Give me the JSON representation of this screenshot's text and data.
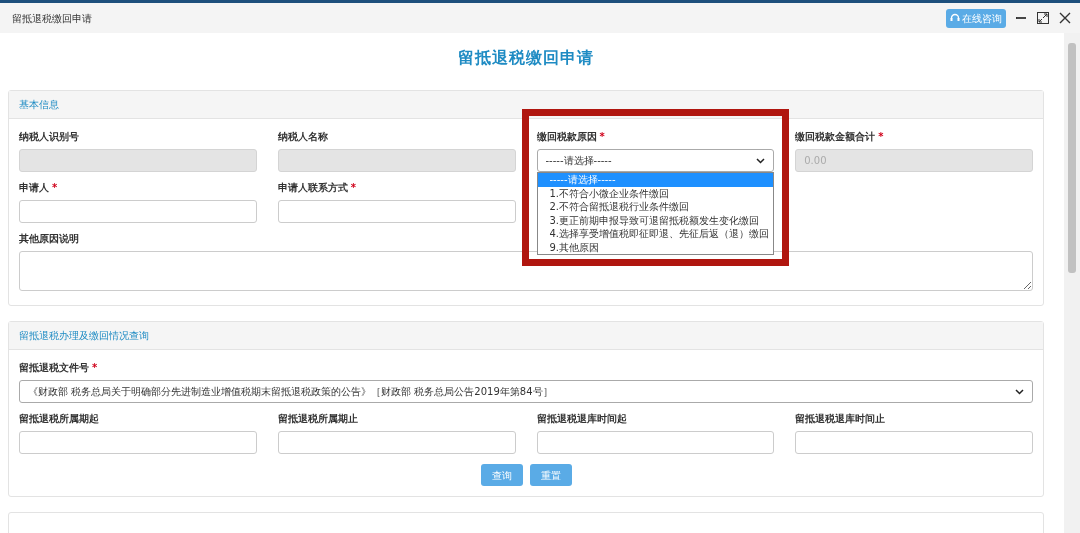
{
  "window": {
    "title": "留抵退税缴回申请",
    "consult_button": "在线咨询"
  },
  "page_title": "留抵退税缴回申请",
  "basic_info": {
    "header": "基本信息",
    "fields": [
      {
        "kind": "input",
        "label": "纳税人识别号",
        "readonly": true
      },
      {
        "kind": "input",
        "label": "纳税人名称",
        "readonly": true
      },
      {
        "kind": "select",
        "label": "缴回税款原因",
        "required_mark": "*",
        "value": "-----请选择-----",
        "highlighted": true,
        "expanded": true,
        "options": [
          {
            "label": "-----请选择-----",
            "selected": true
          },
          {
            "label": "1.不符合小微企业条件缴回",
            "selected": false
          },
          {
            "label": "2.不符合留抵退税行业条件缴回",
            "selected": false
          },
          {
            "label": "3.更正前期申报导致可退留抵税额发生变化缴回",
            "selected": false
          },
          {
            "label": "4.选择享受增值税即征即退、先征后返（退）缴回",
            "selected": false
          },
          {
            "label": "9.其他原因",
            "selected": false
          }
        ]
      },
      {
        "kind": "input",
        "label": "缴回税款金额合计",
        "required_mark": "*",
        "readonly": true,
        "placeholder": "0.00"
      },
      {
        "kind": "input",
        "label": "申请人",
        "required_mark": "*",
        "readonly": false
      },
      {
        "kind": "input",
        "label": "申请人联系方式",
        "required_mark": "*",
        "readonly": false
      },
      {
        "kind": "textarea",
        "label": "其他原因说明",
        "readonly": false
      }
    ]
  },
  "query": {
    "header": "留抵退税办理及缴回情况查询",
    "fields": [
      {
        "kind": "wide-select",
        "label": "留抵退税文件号",
        "required_mark": "*",
        "value": "《财政部 税务总局关于明确部分先进制造业增值税期末留抵退税政策的公告》［财政部 税务总局公告2019年第84号］"
      },
      {
        "kind": "input",
        "label": "留抵退税所属期起",
        "readonly": false
      },
      {
        "kind": "input",
        "label": "留抵退税所属期止",
        "readonly": false
      },
      {
        "kind": "input",
        "label": "留抵退税退库时间起",
        "readonly": false
      },
      {
        "kind": "input",
        "label": "留抵退税退库时间止",
        "readonly": false
      }
    ],
    "buttons": [
      "查询",
      "重置"
    ]
  }
}
